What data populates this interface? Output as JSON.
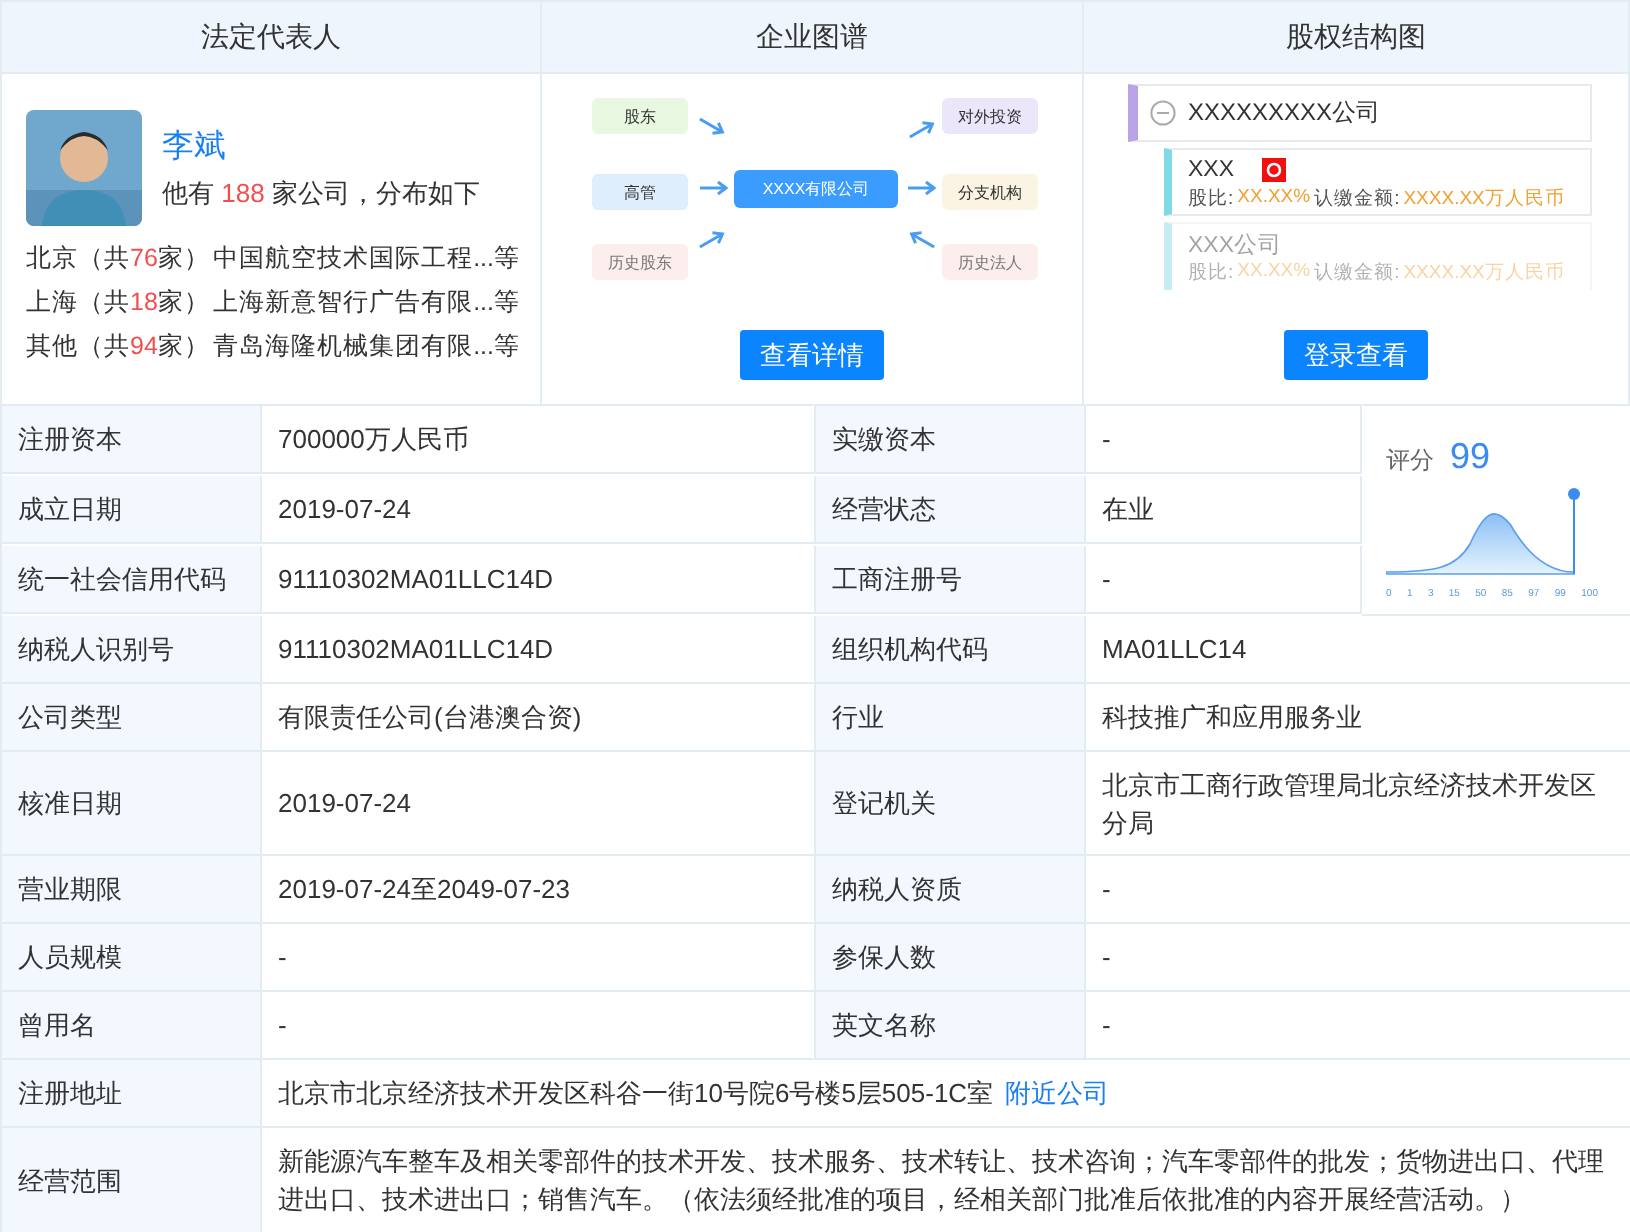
{
  "top_panels": {
    "headers": [
      "法定代表人",
      "企业图谱",
      "股权结构图"
    ],
    "legal_rep": {
      "name": "李斌",
      "summary_before": "他有",
      "company_count": "188",
      "summary_after": "家公司，分布如下",
      "regions": [
        {
          "region": "北京",
          "count_prefix": "（共",
          "count": "76",
          "count_suffix": "家）",
          "companies": "中国航空技术国际工程...等"
        },
        {
          "region": "上海",
          "count_prefix": "（共",
          "count": "18",
          "count_suffix": "家）",
          "companies": "上海新意智行广告有限...等"
        },
        {
          "region": "其他",
          "count_prefix": "（共",
          "count": "94",
          "count_suffix": "家）",
          "companies": "青岛海隆机械集团有限...等"
        }
      ]
    },
    "graph": {
      "center": "XXXX有限公司",
      "left_nodes": [
        {
          "label": "股东",
          "color": "#e8f7e0",
          "faded": false
        },
        {
          "label": "高管",
          "color": "#deeefc",
          "faded": false
        },
        {
          "label": "历史股东",
          "color": "#fdeeee",
          "faded": true
        }
      ],
      "right_nodes": [
        {
          "label": "对外投资",
          "color": "#ece6fb",
          "faded": false
        },
        {
          "label": "分支机构",
          "color": "#fbf4e2",
          "faded": false
        },
        {
          "label": "历史法人",
          "color": "#fdeeee",
          "faded": true
        }
      ],
      "button": "查看详情"
    },
    "equity": {
      "root": "XXXXXXXXX公司",
      "children": [
        {
          "name": "XXX",
          "flag": true,
          "faded": false,
          "ratio_label": "股比:",
          "ratio": "XX.XX%",
          "amount_label": "认缴金额:",
          "amount": "XXXX.XX万人民币"
        },
        {
          "name": "XXX公司",
          "flag": false,
          "faded": true,
          "ratio_label": "股比:",
          "ratio": "XX.XX%",
          "amount_label": "认缴金额:",
          "amount": "XXXX.XX万人民币"
        }
      ],
      "button": "登录查看"
    }
  },
  "score": {
    "label": "评分",
    "value": "99",
    "axis_labels": [
      "0",
      "1",
      "3",
      "15",
      "50",
      "85",
      "97",
      "99",
      "100"
    ]
  },
  "rows": [
    {
      "kind": "pair",
      "label": "注册资本",
      "value": "700000万人民币",
      "label2": "实缴资本",
      "value2": "-"
    },
    {
      "kind": "pair",
      "label": "成立日期",
      "value": "2019-07-24",
      "label2": "经营状态",
      "value2": "在业"
    },
    {
      "kind": "pair",
      "label": "统一社会信用代码",
      "value": "91110302MA01LLC14D",
      "label2": "工商注册号",
      "value2": "-"
    },
    {
      "kind": "pair",
      "label": "纳税人识别号",
      "value": "91110302MA01LLC14D",
      "label2": "组织机构代码",
      "value2": "MA01LLC14"
    },
    {
      "kind": "pair",
      "label": "公司类型",
      "value": "有限责任公司(台港澳合资)",
      "label2": "行业",
      "value2": "科技推广和应用服务业"
    },
    {
      "kind": "pair",
      "label": "核准日期",
      "value": "2019-07-24",
      "label2": "登记机关",
      "value2": "北京市工商行政管理局北京经济技术开发区分局"
    },
    {
      "kind": "pair",
      "label": "营业期限",
      "value": "2019-07-24至2049-07-23",
      "label2": "纳税人资质",
      "value2": "-"
    },
    {
      "kind": "pair",
      "label": "人员规模",
      "value": "-",
      "label2": "参保人数",
      "value2": "-"
    },
    {
      "kind": "pair",
      "label": "曾用名",
      "value": "-",
      "label2": "英文名称",
      "value2": "-"
    },
    {
      "kind": "full",
      "label": "注册地址",
      "value": "北京市北京经济技术开发区科谷一街10号院6号楼5层505-1C室",
      "link": "附近公司"
    },
    {
      "kind": "full",
      "label": "经营范围",
      "value": "新能源汽车整车及相关零部件的技术开发、技术服务、技术转让、技术咨询；汽车零部件的批发；货物进出口、代理进出口、技术进出口；销售汽车。（依法须经批准的项目，经相关部门批准后依批准的内容开展经营活动。）"
    }
  ]
}
